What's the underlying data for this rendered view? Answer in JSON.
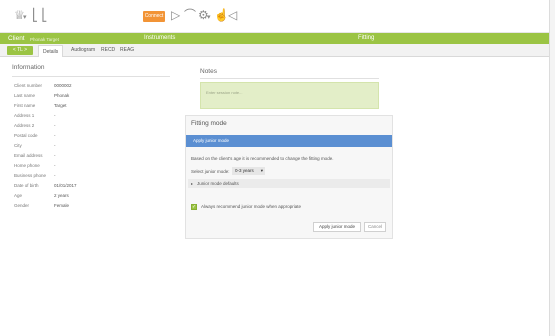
{
  "toolbar": {
    "connect_label": "Connect",
    "icons": [
      "person-icon",
      "chevron-down-icon",
      "play-icon",
      "hand-icon",
      "settings-icon",
      "chevron-down-icon",
      "hand-icon",
      "speaker-icon"
    ]
  },
  "ribbon": {
    "client_label": "Client",
    "client_name": "Phonak Target",
    "instruments_label": "Instruments",
    "fitting_label": "Fitting",
    "back_label": "< TL >",
    "tabs": [
      "Details",
      "Audiogram",
      "RECD",
      "REAG"
    ],
    "active_tab": "Details"
  },
  "information": {
    "heading": "Information",
    "rows": [
      {
        "label": "Client number",
        "value": "0000002"
      },
      {
        "label": "Last name",
        "value": "Phonak"
      },
      {
        "label": "First name",
        "value": "Target"
      },
      {
        "label": "Address 1",
        "value": "-"
      },
      {
        "label": "Address 2",
        "value": "-"
      },
      {
        "label": "Postal code",
        "value": "-"
      },
      {
        "label": "City",
        "value": "-"
      },
      {
        "label": "Email address",
        "value": "-"
      },
      {
        "label": "Home phone",
        "value": "-"
      },
      {
        "label": "Business phone",
        "value": "-"
      },
      {
        "label": "Date of birth",
        "value": "01/01/2017"
      },
      {
        "label": "Age",
        "value": "2 years"
      },
      {
        "label": "Gender",
        "value": "Female"
      }
    ]
  },
  "notes": {
    "heading": "Notes",
    "placeholder": "Enter session note..."
  },
  "fitting_mode": {
    "title": "Fitting mode",
    "bar_label": "Apply junior mode",
    "description": "Based on the client's age it is recommended to change the fitting mode.",
    "select_label": "Select junior mode:",
    "select_value": "0-3 years",
    "expander_label": "Junior mode defaults",
    "checkbox_label": "Always recommend junior mode when appropriate",
    "checkbox_checked": true,
    "apply_label": "Apply junior mode",
    "cancel_label": "Cancel"
  },
  "colors": {
    "accent_green": "#9bc444",
    "connect_orange": "#f29436",
    "selection_blue": "#5b8fd2"
  }
}
